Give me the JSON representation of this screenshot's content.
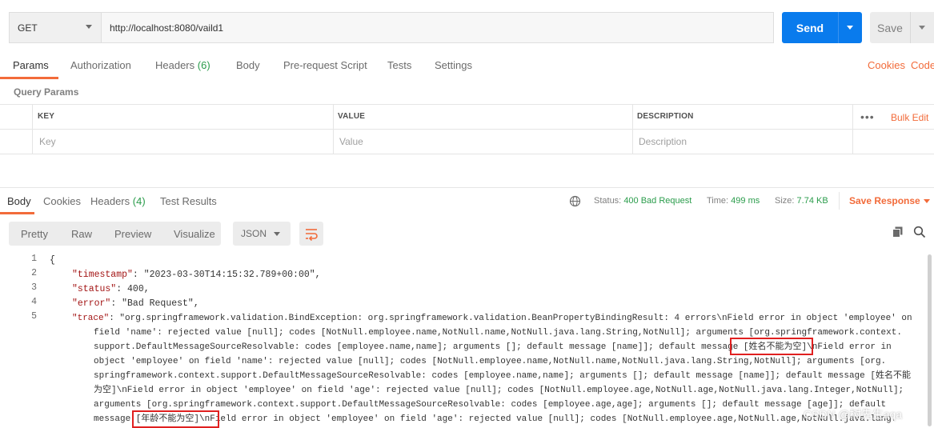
{
  "request": {
    "method": "GET",
    "url": "http://localhost:8080/vaild1",
    "send_label": "Send",
    "save_label": "Save"
  },
  "request_tabs": [
    {
      "label": "Params",
      "count": ""
    },
    {
      "label": "Authorization",
      "count": ""
    },
    {
      "label": "Headers",
      "count": "(6)"
    },
    {
      "label": "Body",
      "count": ""
    },
    {
      "label": "Pre-request Script",
      "count": ""
    },
    {
      "label": "Tests",
      "count": ""
    },
    {
      "label": "Settings",
      "count": ""
    }
  ],
  "right_links": {
    "cookies": "Cookies",
    "code": "Code"
  },
  "query_params": {
    "title": "Query Params",
    "columns": [
      "KEY",
      "VALUE",
      "DESCRIPTION"
    ],
    "placeholders": [
      "Key",
      "Value",
      "Description"
    ],
    "bulk_edit": "Bulk Edit",
    "more": "•••"
  },
  "response_tabs": [
    {
      "label": "Body",
      "count": ""
    },
    {
      "label": "Cookies",
      "count": ""
    },
    {
      "label": "Headers",
      "count": "(4)"
    },
    {
      "label": "Test Results",
      "count": ""
    }
  ],
  "response_meta": {
    "status_label": "Status:",
    "status_value": "400 Bad Request",
    "time_label": "Time:",
    "time_value": "499 ms",
    "size_label": "Size:",
    "size_value": "7.74 KB",
    "save_response": "Save Response"
  },
  "view_modes": [
    "Pretty",
    "Raw",
    "Preview",
    "Visualize"
  ],
  "format": "JSON",
  "line_numbers": [
    "1",
    "2",
    "3",
    "4",
    "5"
  ],
  "code_lines": {
    "l1": "{",
    "l2_key": "\"timestamp\"",
    "l2_val": ": \"2023-03-30T14:15:32.789+00:00\",",
    "l3_key": "\"status\"",
    "l3_val": ": 400,",
    "l4_key": "\"error\"",
    "l4_val": ": \"Bad Request\",",
    "l5_key": "\"trace\"",
    "l5_a": ": \"org.springframework.validation.BindException: org.springframework.validation.BeanPropertyBindingResult: 4 errors\\nField error in object 'employee' on",
    "l5_b": "field 'name': rejected value [null]; codes [NotNull.employee.name,NotNull.name,NotNull.java.lang.String,NotNull]; arguments [org.springframework.context.",
    "l5_c": "support.DefaultMessageSourceResolvable: codes [employee.name,name]; arguments []; default message [name]]; default message [姓名不能为空]\\nField error in",
    "l5_d": "object 'employee' on field 'name': rejected value [null]; codes [NotNull.employee.name,NotNull.name,NotNull.java.lang.String,NotNull]; arguments [org.",
    "l5_e": "springframework.context.support.DefaultMessageSourceResolvable: codes [employee.name,name]; arguments []; default message [name]]; default message [姓名不能",
    "l5_f": "为空]\\nField error in object 'employee' on field 'age': rejected value [null]; codes [NotNull.employee.age,NotNull.age,NotNull.java.lang.Integer,NotNull];",
    "l5_g": "arguments [org.springframework.context.support.DefaultMessageSourceResolvable: codes [employee.age,age]; arguments []; default message [age]]; default",
    "l5_h": "message [年龄不能为空]\\nField error in object 'employee' on field 'age': rejected value [null]; codes [NotNull.employee.age,NotNull.age,NotNull.java.lang."
  },
  "watermark": "CSDN @树先生aqa",
  "colors": {
    "accent": "#f26b3a",
    "send": "#097bed",
    "success": "#2a9c4b",
    "highlight": "#e02020"
  }
}
